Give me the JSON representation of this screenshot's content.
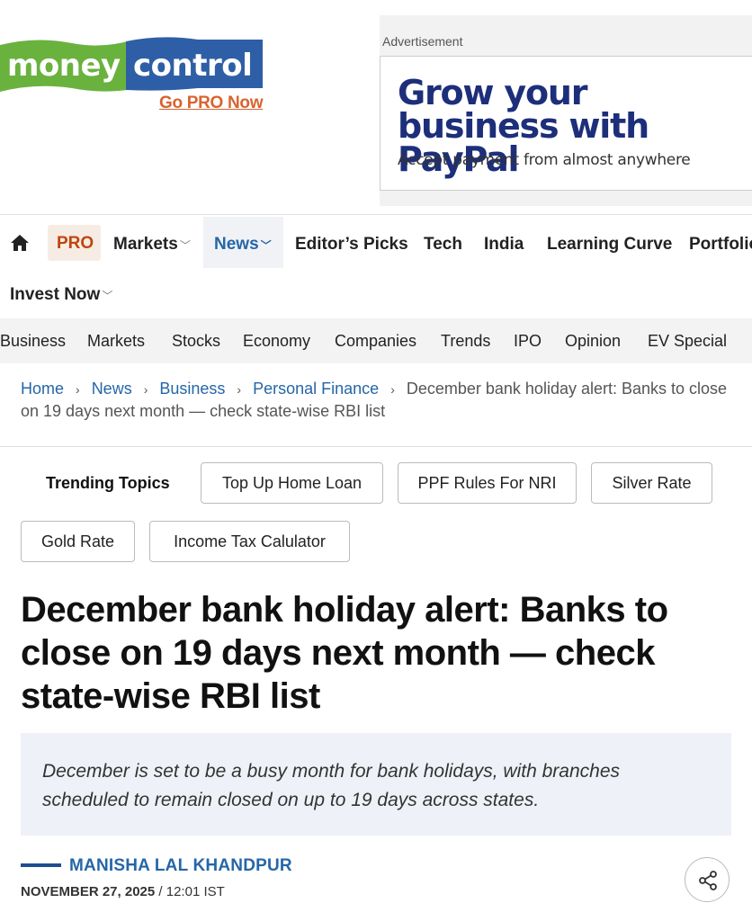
{
  "header": {
    "logo_left": "money",
    "logo_right": "control",
    "go_pro": "Go PRO Now",
    "colors": {
      "logo_green": "#6ab23e",
      "logo_blue": "#2e5fa6",
      "go_pro": "#d9632f"
    }
  },
  "ad": {
    "label": "Advertisement",
    "headline": "Grow your business with PayPal",
    "subtext": "Accept payment from almost anywhere"
  },
  "main_nav": {
    "home_icon": "home-icon",
    "items": [
      "PRO",
      "Markets",
      "News",
      "Editor’s Picks",
      "Tech",
      "India",
      "Learning Curve",
      "Portfolio",
      "Invest Now"
    ]
  },
  "sub_nav": {
    "items": [
      "Business",
      "Markets",
      "Stocks",
      "Economy",
      "Companies",
      "Trends",
      "IPO",
      "Opinion",
      "EV Special"
    ]
  },
  "breadcrumb": {
    "items": [
      "Home",
      "News",
      "Business",
      "Personal Finance"
    ],
    "current": "December bank holiday alert: Banks to close on 19 days next month — check state-wise RBI list"
  },
  "trending": {
    "label": "Trending Topics",
    "topics": [
      "Top Up Home Loan",
      "PPF Rules For NRI",
      "Silver Rate",
      "Gold Rate",
      "Income Tax Calulator"
    ]
  },
  "article": {
    "headline": "December bank holiday alert: Banks to close on 19 days next month — check state-wise RBI list",
    "summary": "December is set to be a busy month for bank holidays, with branches scheduled to remain closed on up to 19 days across states.",
    "author": "MANISHA LAL KHANDPUR",
    "date": "NOVEMBER 27, 2025",
    "time": "12:01 IST",
    "share_icon": "share-icon"
  }
}
